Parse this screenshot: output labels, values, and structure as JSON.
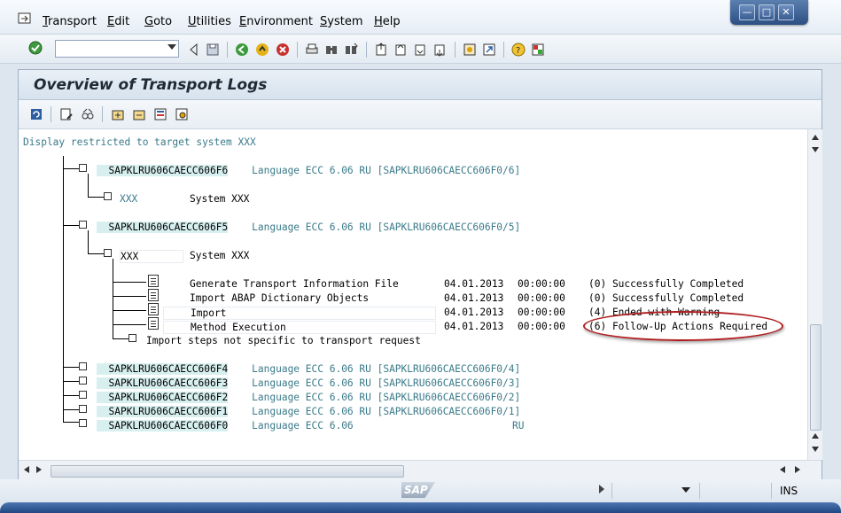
{
  "menu": {
    "items": [
      {
        "ul": "T",
        "rest": "ransport"
      },
      {
        "ul": "E",
        "rest": "dit"
      },
      {
        "ul": "G",
        "rest": "oto"
      },
      {
        "ul": "U",
        "rest": "tilities"
      },
      {
        "ul": "E",
        "rest": "nvironment",
        "pre": ""
      },
      {
        "ul": "S",
        "rest": "ystem"
      },
      {
        "ul": "H",
        "rest": "elp"
      }
    ],
    "icon": "sap-menu-icon"
  },
  "window_controls": {
    "minimize": "—",
    "maximize": "□",
    "close": "✕"
  },
  "toolbar": {
    "okcode_value": "",
    "icons": [
      "enter-icon",
      "back-nav-icon",
      "save-icon",
      "back-icon",
      "exit-icon",
      "cancel-icon",
      "print-icon",
      "find-icon",
      "find-next-icon",
      "first-page-icon",
      "prev-page-icon",
      "next-page-icon",
      "last-page-icon",
      "new-session-icon",
      "shortcut-icon",
      "help-icon",
      "layout-icon"
    ]
  },
  "page": {
    "title": "Overview of Transport Logs",
    "app_icons": [
      "refresh-icon",
      "display-log-icon",
      "glasses-icon",
      "expand-icon",
      "collapse-icon",
      "legend-icon",
      "settings-icon"
    ]
  },
  "log": {
    "restriction": "Display restricted to target system XXX",
    "requests": [
      {
        "id": "SAPKLRU606CAECC606F6",
        "desc": "Language ECC 6.06 RU [SAPKLRU606CAECC606F0/6]"
      },
      {
        "id": "SAPKLRU606CAECC606F5",
        "desc": "Language ECC 6.06 RU [SAPKLRU606CAECC606F0/5]"
      },
      {
        "id": "SAPKLRU606CAECC606F4",
        "desc": "Language ECC 6.06 RU [SAPKLRU606CAECC606F0/4]"
      },
      {
        "id": "SAPKLRU606CAECC606F3",
        "desc": "Language ECC 6.06 RU [SAPKLRU606CAECC606F0/3]"
      },
      {
        "id": "SAPKLRU606CAECC606F2",
        "desc": "Language ECC 6.06 RU [SAPKLRU606CAECC606F0/2]"
      },
      {
        "id": "SAPKLRU606CAECC606F1",
        "desc": "Language ECC 6.06 RU [SAPKLRU606CAECC606F0/1]"
      },
      {
        "id": "SAPKLRU606CAECC606F0",
        "desc": "Language ECC 6.06",
        "suffix": "RU"
      }
    ],
    "system_node": {
      "name": "XXX",
      "label": "System XXX"
    },
    "steps": [
      {
        "name": "Generate Transport Information File",
        "date": "04.01.2013",
        "time": "00:00:00",
        "status": "(0) Successfully Completed"
      },
      {
        "name": "Import ABAP Dictionary Objects",
        "date": "04.01.2013",
        "time": "00:00:00",
        "status": "(0) Successfully Completed"
      },
      {
        "name": "Import",
        "date": "04.01.2013",
        "time": "00:00:00",
        "status": "(4) Ended with Warning"
      },
      {
        "name": "Method Execution",
        "date": "04.01.2013",
        "time": "00:00:00",
        "status": "(6) Follow-Up Actions Required"
      }
    ],
    "non_specific": "Import steps not specific to transport request"
  },
  "status": {
    "logo": "SAP",
    "mode": "INS"
  }
}
